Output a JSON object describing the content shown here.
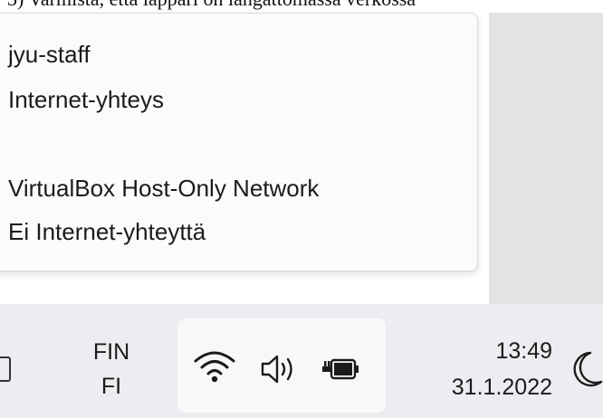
{
  "document": {
    "fragment_text": "3) Varmista, että läppäri on langattomassa verkossa"
  },
  "network_flyout": {
    "networks": [
      {
        "name": "jyu-staff",
        "status": "Internet-yhteys"
      },
      {
        "name": "VirtualBox Host-Only Network",
        "status": "Ei Internet-yhteyttä"
      }
    ]
  },
  "taskbar": {
    "language": {
      "line1": "FIN",
      "line2": "FI"
    },
    "tray_icons": [
      "wifi-icon",
      "volume-icon",
      "battery-charging-icon"
    ],
    "clock": {
      "time": "13:49",
      "date": "31.1.2022"
    },
    "focus_icon": "moon-icon"
  }
}
